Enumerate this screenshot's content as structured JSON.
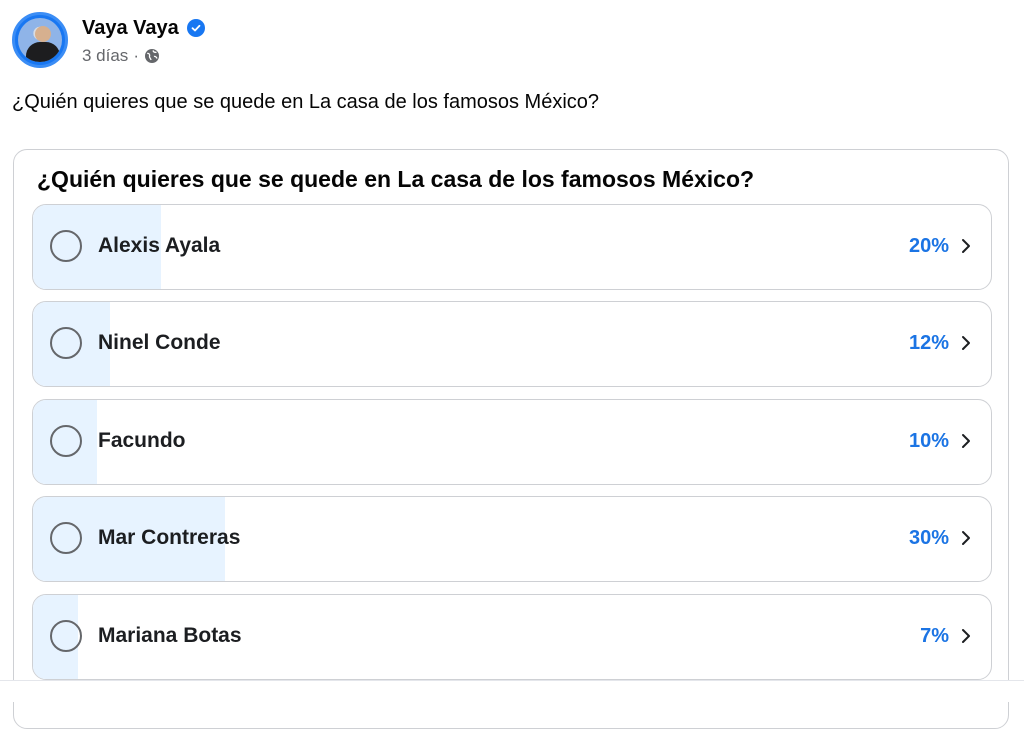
{
  "post": {
    "author_name": "Vaya Vaya",
    "time_ago": "3 días",
    "separator": "·",
    "audience_icon": "globe-icon",
    "verified_icon": "verified-badge-icon",
    "text": "¿Quién quieres que se quede en La casa de los famosos México?"
  },
  "poll": {
    "question": "¿Quién quieres que se quede en La casa de los famosos México?",
    "options": [
      {
        "label": "Alexis Ayala",
        "percent_text": "20%",
        "fill_percent": 20
      },
      {
        "label": "Ninel Conde",
        "percent_text": "12%",
        "fill_percent": 12
      },
      {
        "label": "Facundo",
        "percent_text": "10%",
        "fill_percent": 10
      },
      {
        "label": "Mar Contreras",
        "percent_text": "30%",
        "fill_percent": 30
      },
      {
        "label": "Mariana Botas",
        "percent_text": "7%",
        "fill_percent": 7
      }
    ]
  },
  "colors": {
    "accent_blue": "#1b74e4",
    "fill_bar": "#e7f3ff",
    "border": "#ced0d4",
    "meta_gray": "#65676b"
  }
}
